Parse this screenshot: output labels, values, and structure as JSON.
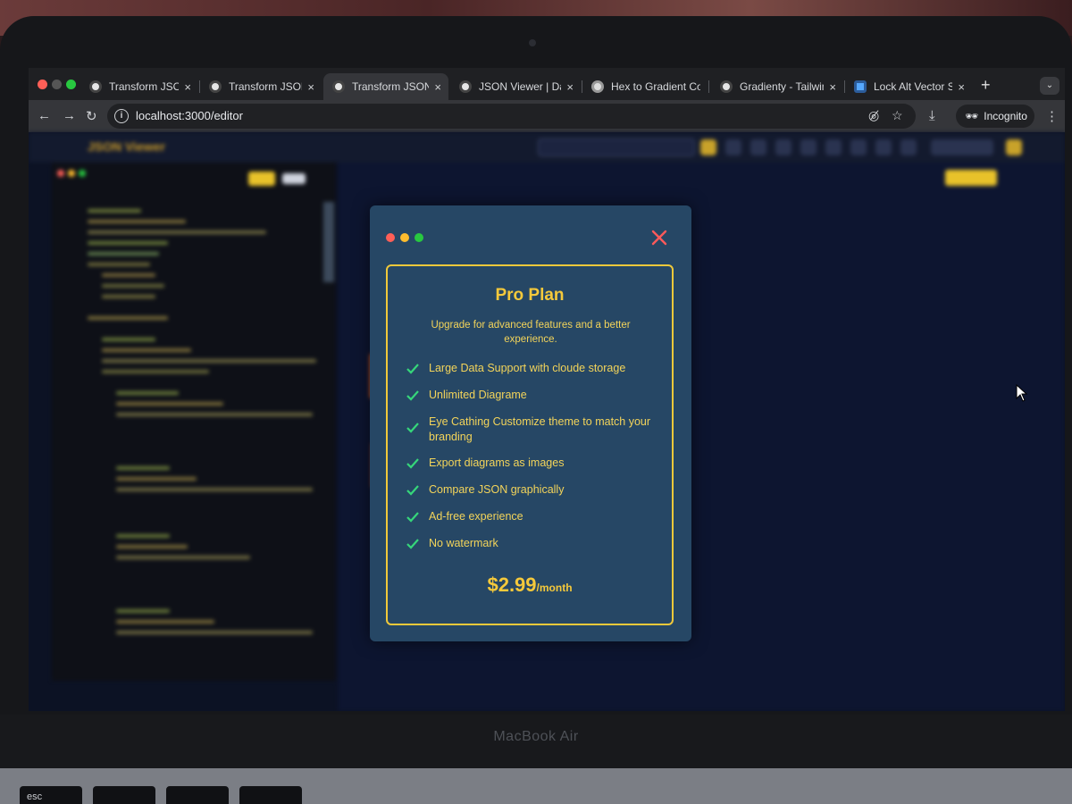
{
  "device": {
    "brand": "MacBook Air",
    "keys": [
      "esc"
    ]
  },
  "browser": {
    "tabs": [
      {
        "title": "Transform JSON to",
        "close": "×",
        "active": false,
        "favicon": "circle-favicon"
      },
      {
        "title": "Transform JSON to",
        "close": "×",
        "active": false,
        "favicon": "circle-favicon"
      },
      {
        "title": "Transform JSON to",
        "close": "×",
        "active": true,
        "favicon": "circle-favicon"
      },
      {
        "title": "JSON Viewer | Das",
        "close": "×",
        "active": false,
        "favicon": "circle-favicon"
      },
      {
        "title": "Hex to Gradient Co",
        "close": "×",
        "active": false,
        "favicon": "circle-favicon"
      },
      {
        "title": "Gradienty - Tailwin",
        "close": "×",
        "active": false,
        "favicon": "circle-favicon"
      },
      {
        "title": "Lock Alt Vector SV",
        "close": "×",
        "active": false,
        "favicon": "square-favicon"
      }
    ],
    "new_tab": "+",
    "url": "localhost:3000/editor",
    "profile_label": "Incognito"
  },
  "app": {
    "logo": "JSON Viewer"
  },
  "modal": {
    "title": "Pro Plan",
    "subtitle": "Upgrade for advanced features and a better experience.",
    "features": [
      "Large Data Support with cloude storage",
      "Unlimited Diagrame",
      "Eye Cathing Customize theme to match your branding",
      "Export diagrams as images",
      "Compare JSON graphically",
      "Ad-free experience",
      "No watermark"
    ],
    "price": {
      "amount": "$2.99",
      "period": "/month"
    }
  },
  "colors": {
    "modal_bg": "#264765",
    "accent_yellow": "#f5c93b",
    "check_green": "#36d67a",
    "close_red": "#ff5a5a",
    "node_orange": "#e85a1c",
    "node_yellow": "#f1a52a"
  },
  "icons": [
    "back-icon",
    "forward-icon",
    "reload-icon",
    "info-icon",
    "eye-off-icon",
    "star-icon",
    "download-icon",
    "incognito-icon",
    "menu-dots-icon",
    "close-icon",
    "check-icon",
    "cursor-icon"
  ]
}
